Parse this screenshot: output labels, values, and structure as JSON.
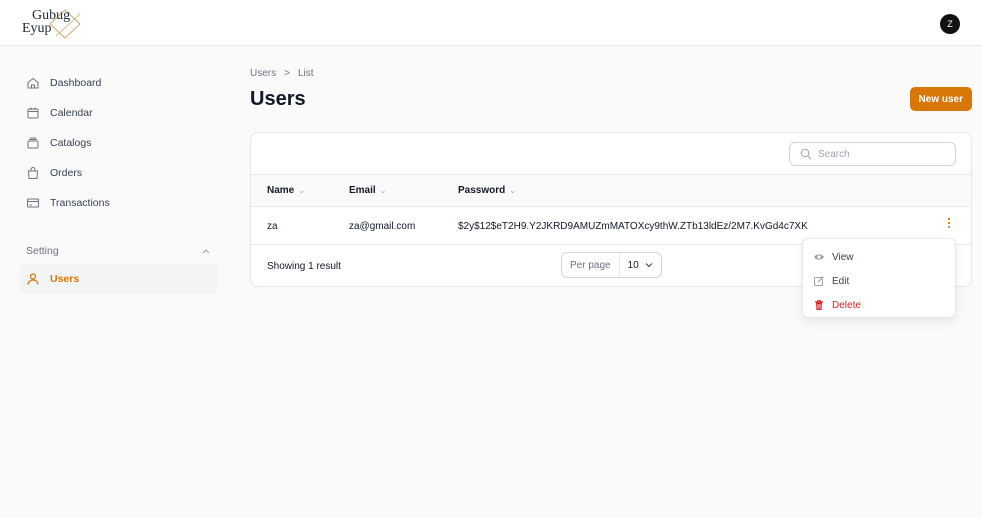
{
  "brand": {
    "logo_line1": "Gubug",
    "logo_line2": "Eyup"
  },
  "user": {
    "avatar_initial": "Z"
  },
  "sidebar": {
    "items": [
      {
        "label": "Dashboard",
        "icon": "home-icon"
      },
      {
        "label": "Calendar",
        "icon": "calendar-icon"
      },
      {
        "label": "Catalogs",
        "icon": "catalog-icon"
      },
      {
        "label": "Orders",
        "icon": "bag-icon"
      },
      {
        "label": "Transactions",
        "icon": "credit-card-icon"
      }
    ],
    "group": {
      "label": "Setting",
      "items": [
        {
          "label": "Users",
          "icon": "user-icon",
          "active": true
        }
      ]
    }
  },
  "breadcrumb": {
    "parent": "Users",
    "separator": ">",
    "current": "List"
  },
  "page": {
    "title": "Users",
    "new_button": "New user"
  },
  "search": {
    "placeholder": "Search"
  },
  "table": {
    "columns": [
      "Name",
      "Email",
      "Password"
    ],
    "rows": [
      {
        "name": "za",
        "email": "za@gmail.com",
        "password": "$2y$12$eT2H9.Y2JKRD9AMUZmMATOXcy9thW.ZTb13ldEz/2M7.KvGd4c7XK"
      }
    ],
    "footer": {
      "summary": "Showing 1 result",
      "per_page_label": "Per page",
      "per_page_value": "10"
    }
  },
  "row_menu": {
    "view": "View",
    "edit": "Edit",
    "delete": "Delete"
  },
  "colors": {
    "accent": "#d97706",
    "danger": "#dc2626"
  }
}
